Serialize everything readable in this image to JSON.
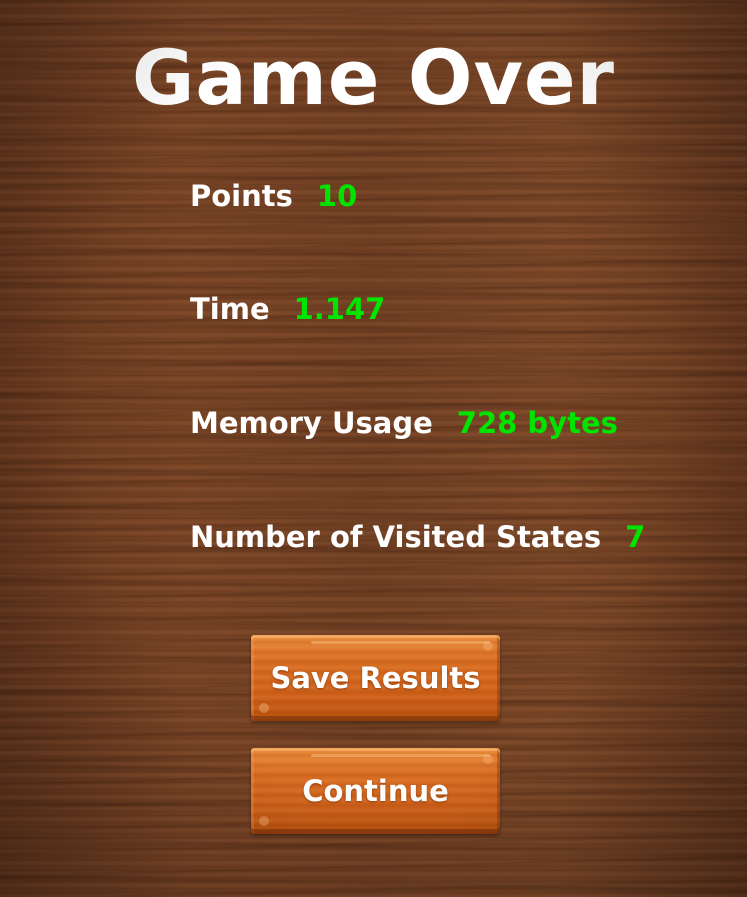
{
  "screen": {
    "title": "Game Over"
  },
  "stats": [
    {
      "label": "Points",
      "value": "10"
    },
    {
      "label": "Time",
      "value": "1.147"
    },
    {
      "label": "Memory Usage",
      "value": "728 bytes"
    },
    {
      "label": "Number of Visited States",
      "value": "7"
    }
  ],
  "buttons": {
    "save_label": "Save Results",
    "continue_label": "Continue"
  },
  "colors": {
    "label": "#ffffff",
    "value": "#00e400",
    "button": "#d96e22",
    "background": "#6e3e22"
  }
}
